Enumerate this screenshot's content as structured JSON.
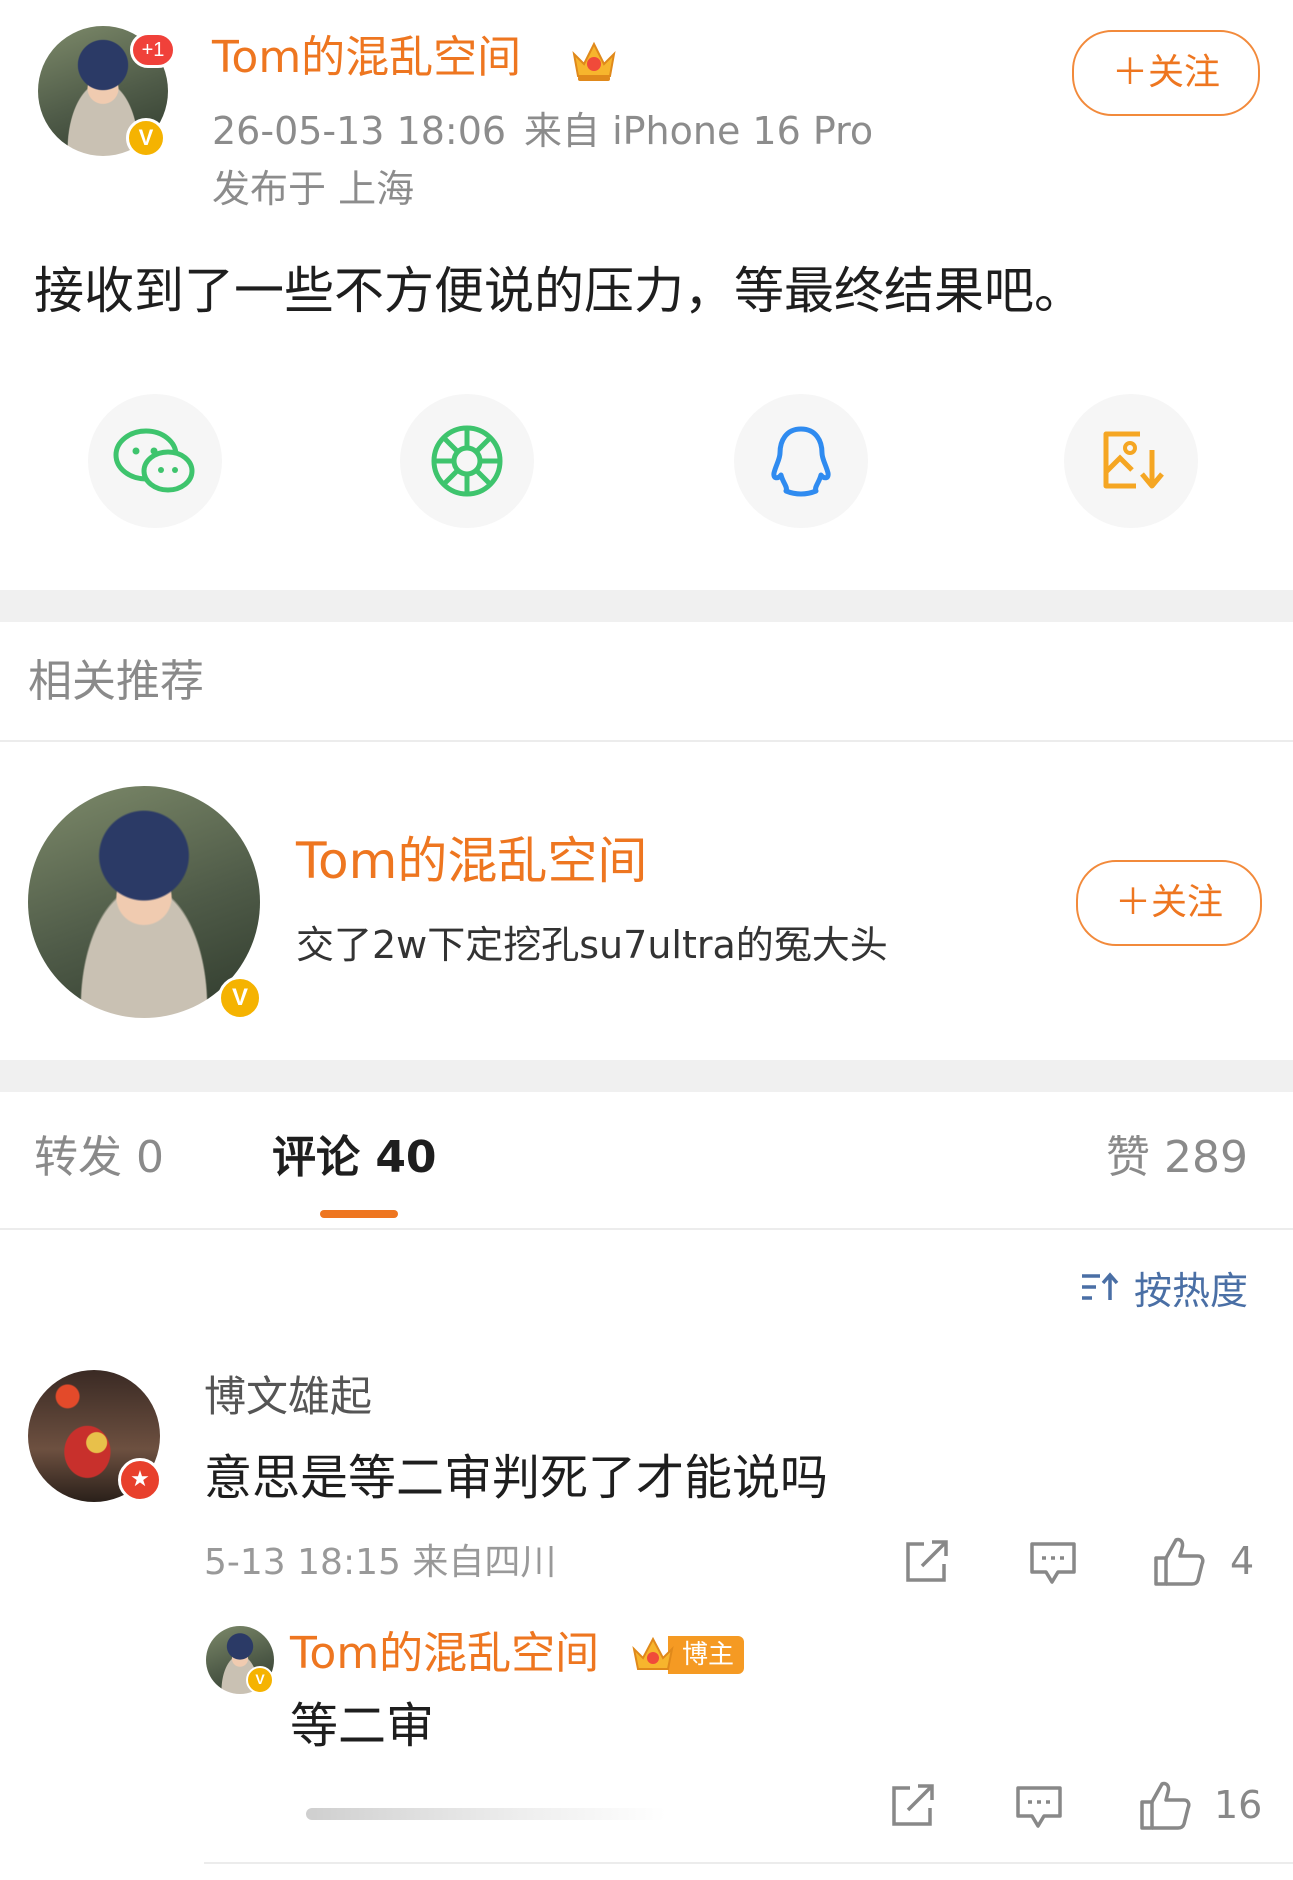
{
  "post": {
    "author": "Tom的混乱空间",
    "crown_icon": "crown-icon",
    "avatar_badge": "+1",
    "time": "26-05-13 18:06",
    "source": "来自 iPhone 16 Pro",
    "location": "发布于 上海",
    "follow_label": "关注",
    "content": "接收到了一些不方便说的压力，等最终结果吧。"
  },
  "share": {
    "items": [
      {
        "name": "wechat-icon",
        "color": "#3ec46d"
      },
      {
        "name": "moments-icon",
        "color": "#3ec46d"
      },
      {
        "name": "qq-icon",
        "color": "#2f8bf0"
      },
      {
        "name": "save-image-icon",
        "color": "#f5a623"
      }
    ]
  },
  "recommend": {
    "section_title": "相关推荐",
    "name": "Tom的混乱空间",
    "description": "交了2w下定挖孔su7ultra的冤大头",
    "follow_label": "关注"
  },
  "tabs": {
    "repost": "转发 0",
    "comments": "评论 40",
    "likes": "赞 289",
    "sort_label": "按热度"
  },
  "comment": {
    "user": "博文雄起",
    "text": "意思是等二审判死了才能说吗",
    "meta": "5-13 18:15 来自四川",
    "like_count": "4",
    "reply": {
      "user": "Tom的混乱空间",
      "badge": "博主",
      "text": "等二审",
      "like_count": "16"
    }
  },
  "colors": {
    "accent": "#ee7620",
    "vip_badge": "#f5b301",
    "sort_blue": "#4a6fa5"
  }
}
